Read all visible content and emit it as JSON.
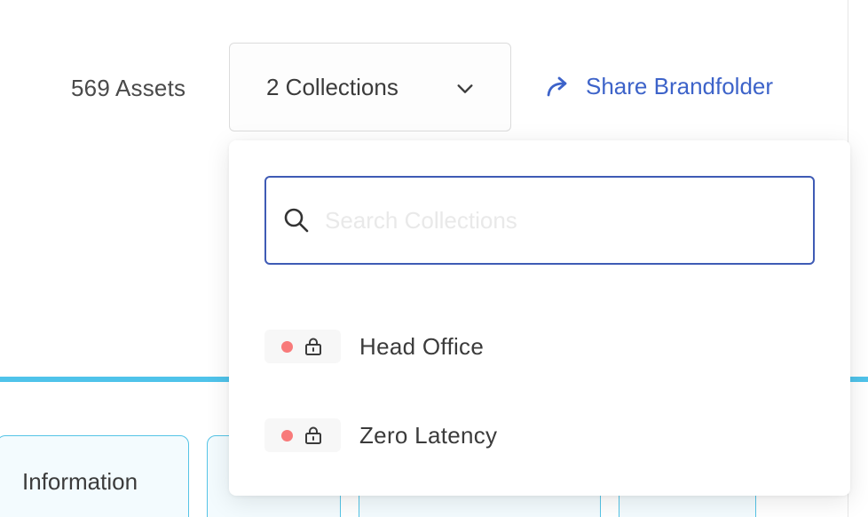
{
  "toolbar": {
    "asset_count": "569 Assets",
    "collections_button_label": "2 Collections",
    "share_label": "Share Brandfolder"
  },
  "dropdown": {
    "search_placeholder": "Search Collections",
    "items": [
      {
        "name": "Head Office",
        "status": "locked"
      },
      {
        "name": "Zero Latency",
        "status": "locked"
      }
    ]
  },
  "tabs": {
    "first_label": "Information"
  },
  "colors": {
    "accent_blue": "#3d63c9",
    "search_border": "#3f5bb5",
    "rule_blue": "#4fc3ea",
    "status_dot": "#f87a7a"
  },
  "icons": {
    "share": "share-arrow-icon",
    "chevron": "chevron-down-icon",
    "search": "search-icon",
    "lock": "lock-icon",
    "status": "status-dot-icon"
  }
}
